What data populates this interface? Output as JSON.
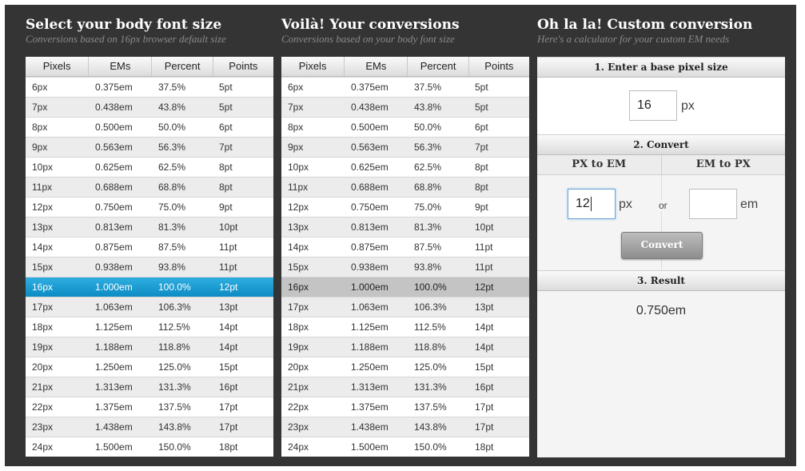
{
  "colors": {
    "frame_bg": "#343434",
    "highlight_blue": "#0d8cc4",
    "highlight_gray": "#c4c4c4"
  },
  "columns": [
    "Pixels",
    "EMs",
    "Percent",
    "Points"
  ],
  "panel1": {
    "title": "Select your body font size",
    "subtitle": "Conversions based on 16px browser default size",
    "selected_row": "16px"
  },
  "panel2": {
    "title": "Voilà! Your conversions",
    "subtitle": "Conversions based on your body font size",
    "highlighted_row": "16px"
  },
  "rows": [
    [
      "6px",
      "0.375em",
      "37.5%",
      "5pt"
    ],
    [
      "7px",
      "0.438em",
      "43.8%",
      "5pt"
    ],
    [
      "8px",
      "0.500em",
      "50.0%",
      "6pt"
    ],
    [
      "9px",
      "0.563em",
      "56.3%",
      "7pt"
    ],
    [
      "10px",
      "0.625em",
      "62.5%",
      "8pt"
    ],
    [
      "11px",
      "0.688em",
      "68.8%",
      "8pt"
    ],
    [
      "12px",
      "0.750em",
      "75.0%",
      "9pt"
    ],
    [
      "13px",
      "0.813em",
      "81.3%",
      "10pt"
    ],
    [
      "14px",
      "0.875em",
      "87.5%",
      "11pt"
    ],
    [
      "15px",
      "0.938em",
      "93.8%",
      "11pt"
    ],
    [
      "16px",
      "1.000em",
      "100.0%",
      "12pt"
    ],
    [
      "17px",
      "1.063em",
      "106.3%",
      "13pt"
    ],
    [
      "18px",
      "1.125em",
      "112.5%",
      "14pt"
    ],
    [
      "19px",
      "1.188em",
      "118.8%",
      "14pt"
    ],
    [
      "20px",
      "1.250em",
      "125.0%",
      "15pt"
    ],
    [
      "21px",
      "1.313em",
      "131.3%",
      "16pt"
    ],
    [
      "22px",
      "1.375em",
      "137.5%",
      "17pt"
    ],
    [
      "23px",
      "1.438em",
      "143.8%",
      "17pt"
    ],
    [
      "24px",
      "1.500em",
      "150.0%",
      "18pt"
    ]
  ],
  "calc": {
    "title": "Oh la la! Custom conversion",
    "subtitle": "Here's a calculator for your custom EM needs",
    "step1_label": "1. Enter a base pixel size",
    "base_value": "16",
    "base_unit": "px",
    "step2_label": "2. Convert",
    "tab_px_to_em": "PX to EM",
    "tab_em_to_px": "EM to PX",
    "px_value": "12",
    "px_unit": "px",
    "or_label": "or",
    "em_value": "",
    "em_unit": "em",
    "convert_label": "Convert",
    "step3_label": "3. Result",
    "result_value": "0.750em"
  }
}
